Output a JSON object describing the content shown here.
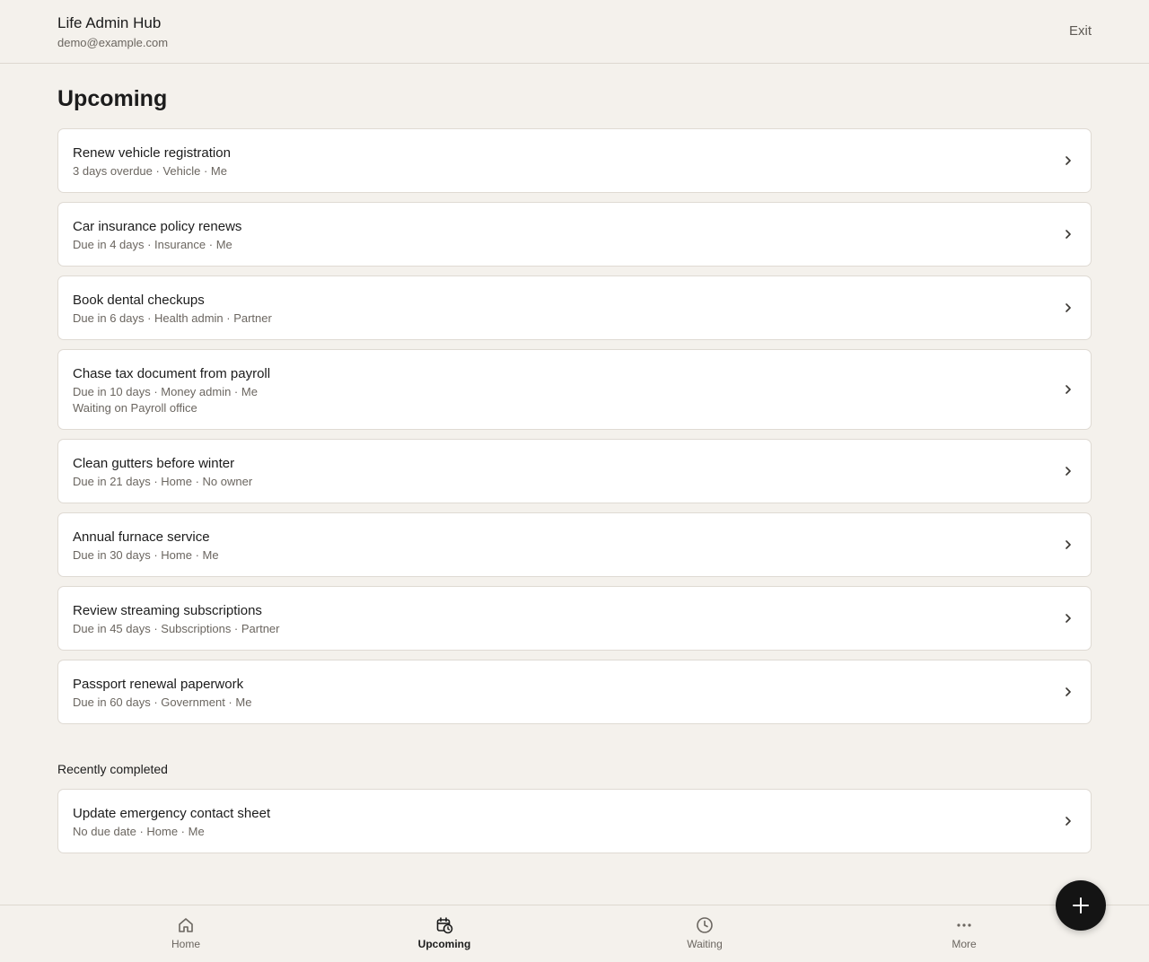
{
  "header": {
    "app_title": "Life Admin Hub",
    "user_email": "demo@example.com",
    "exit_label": "Exit"
  },
  "page": {
    "title": "Upcoming"
  },
  "tasks": [
    {
      "title": "Renew vehicle registration",
      "meta": "3 days overdue · Vehicle · Me"
    },
    {
      "title": "Car insurance policy renews",
      "meta": "Due in 4 days · Insurance · Me"
    },
    {
      "title": "Book dental checkups",
      "meta": "Due in 6 days · Health admin · Partner"
    },
    {
      "title": "Chase tax document from payroll",
      "meta": "Due in 10 days · Money admin · Me",
      "extra": "Waiting on Payroll office"
    },
    {
      "title": "Clean gutters before winter",
      "meta": "Due in 21 days · Home · No owner"
    },
    {
      "title": "Annual furnace service",
      "meta": "Due in 30 days · Home · Me"
    },
    {
      "title": "Review streaming subscriptions",
      "meta": "Due in 45 days · Subscriptions · Partner"
    },
    {
      "title": "Passport renewal paperwork",
      "meta": "Due in 60 days · Government · Me"
    }
  ],
  "completed": {
    "label": "Recently completed",
    "items": [
      {
        "title": "Update emergency contact sheet",
        "meta": "No due date · Home · Me"
      }
    ]
  },
  "nav": {
    "items": [
      {
        "label": "Home",
        "icon": "home-icon"
      },
      {
        "label": "Upcoming",
        "icon": "calendar-clock-icon",
        "active": true
      },
      {
        "label": "Waiting",
        "icon": "clock-icon"
      },
      {
        "label": "More",
        "icon": "more-horizontal-icon"
      }
    ]
  },
  "fab": {
    "icon": "plus-icon"
  },
  "colors": {
    "background": "#f4f1ec",
    "card": "#ffffff",
    "text": "#1c1c1c",
    "muted": "#6b6660",
    "fab": "#141414"
  }
}
